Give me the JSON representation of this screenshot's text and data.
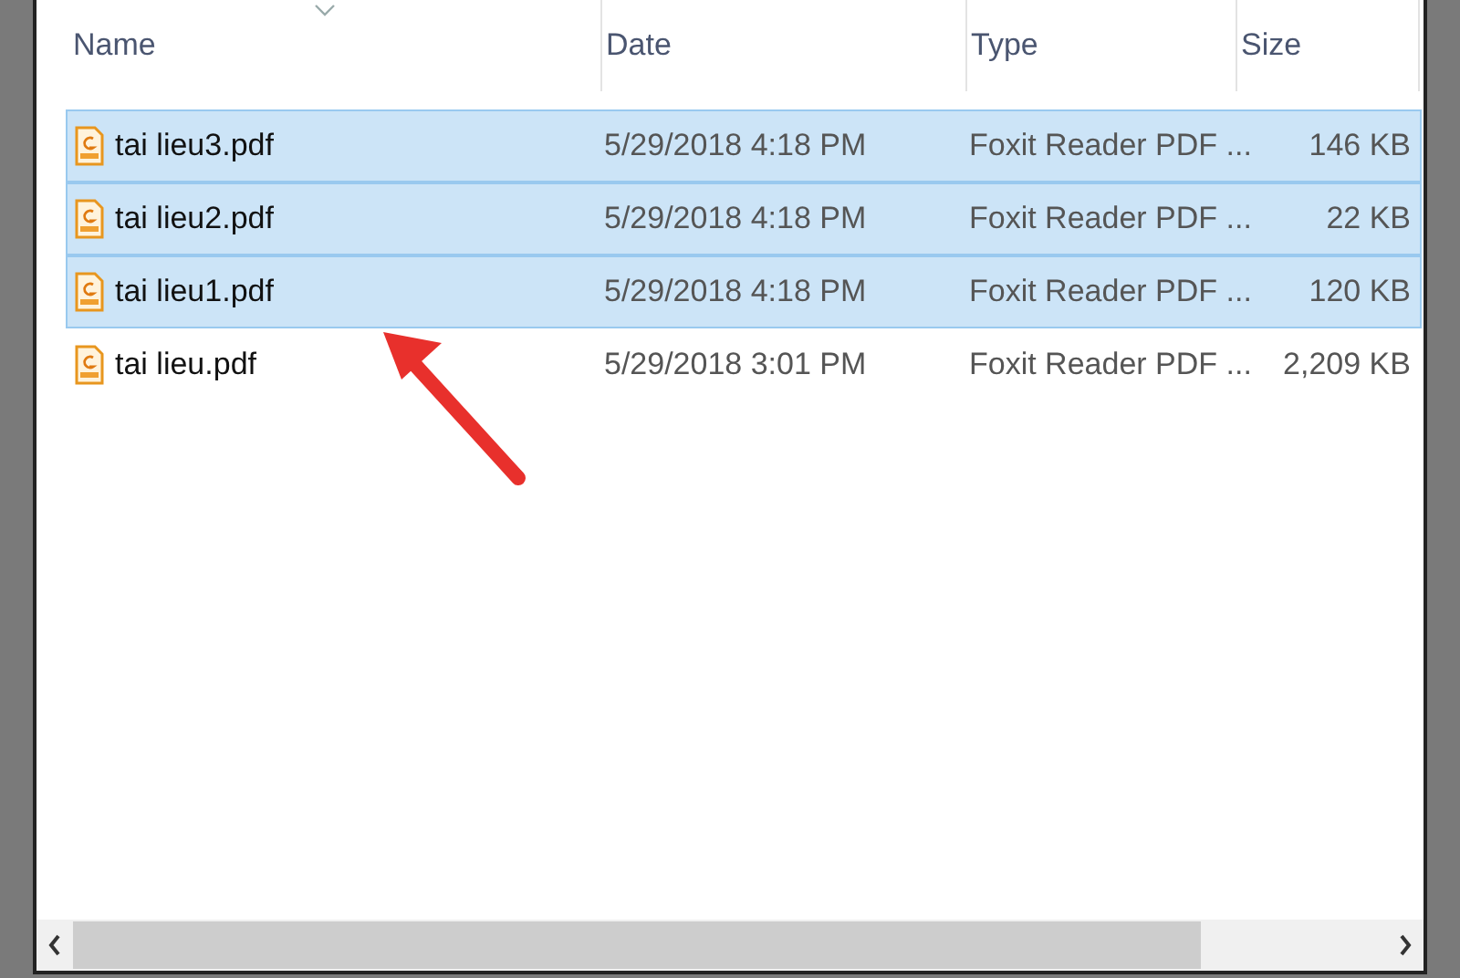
{
  "columns": [
    "Name",
    "Date",
    "Type",
    "Size"
  ],
  "rows": [
    {
      "name": "tai lieu3.pdf",
      "date": "5/29/2018 4:18 PM",
      "type": "Foxit Reader PDF ...",
      "size": "146 KB",
      "selected": true
    },
    {
      "name": "tai lieu2.pdf",
      "date": "5/29/2018 4:18 PM",
      "type": "Foxit Reader PDF ...",
      "size": "22 KB",
      "selected": true
    },
    {
      "name": "tai lieu1.pdf",
      "date": "5/29/2018 4:18 PM",
      "type": "Foxit Reader PDF ...",
      "size": "120 KB",
      "selected": true
    },
    {
      "name": "tai lieu.pdf",
      "date": "5/29/2018 3:01 PM",
      "type": "Foxit Reader PDF ...",
      "size": "2,209 KB",
      "selected": false
    }
  ]
}
